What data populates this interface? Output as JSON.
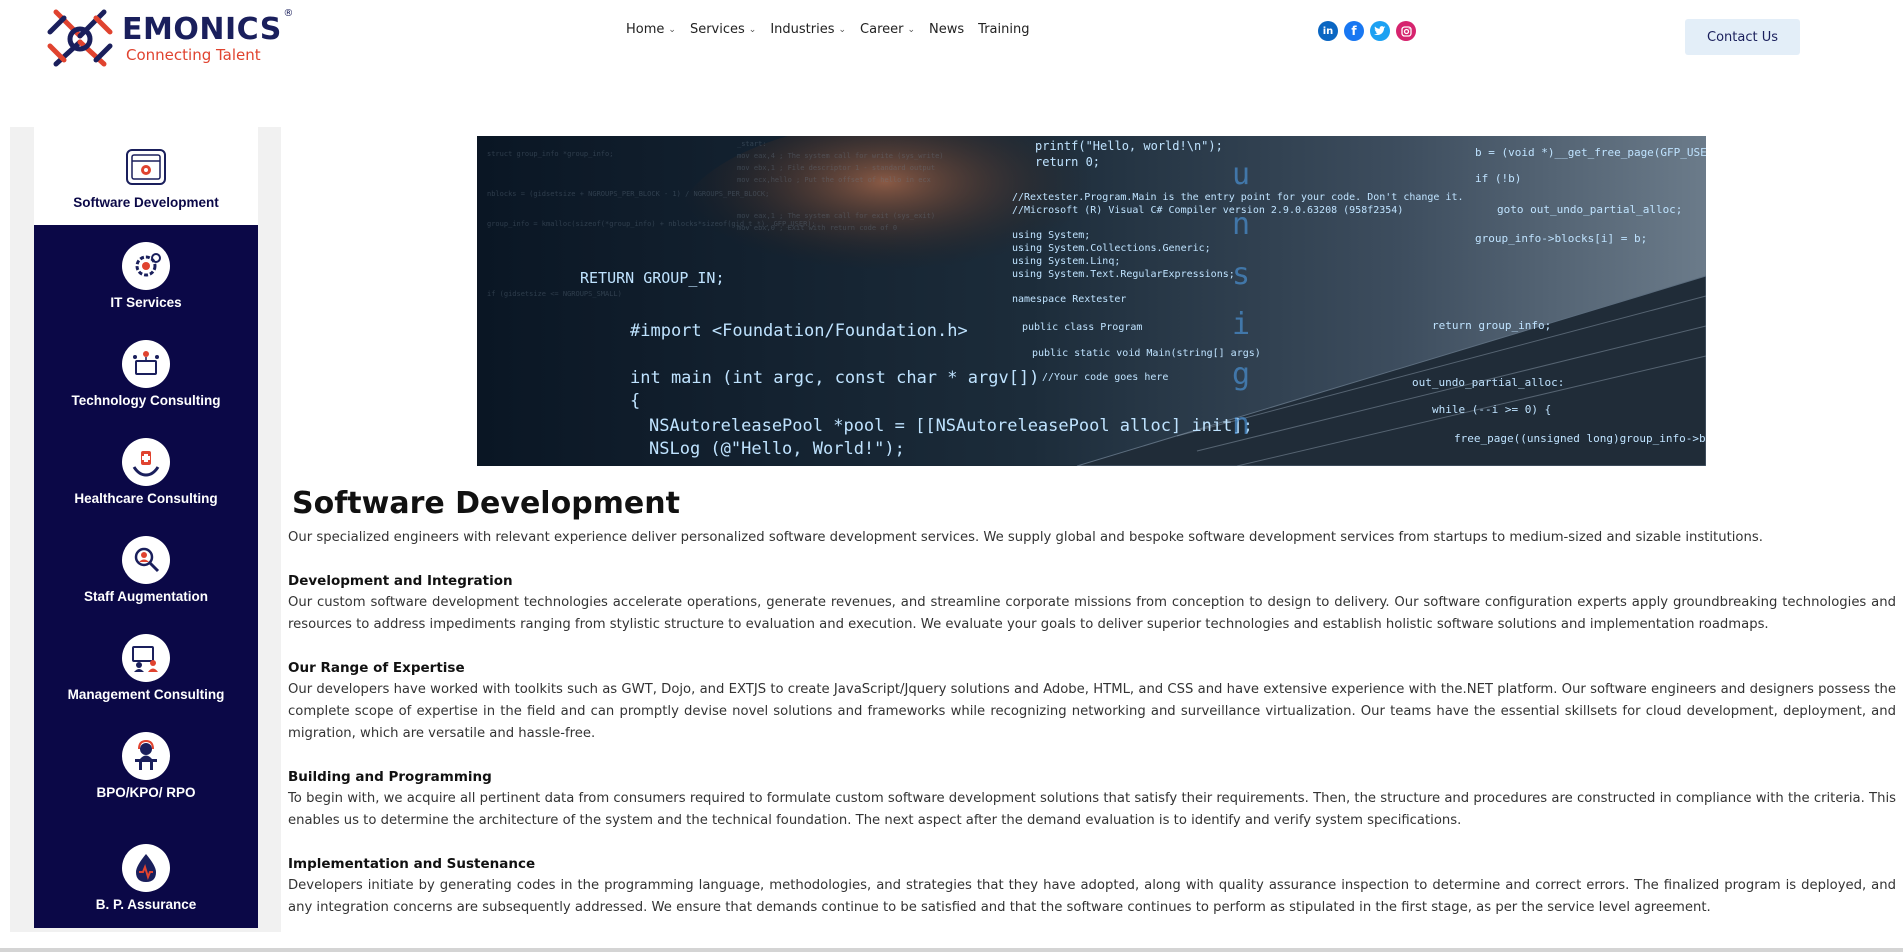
{
  "brand": {
    "name": "EMONICS",
    "registered": "®",
    "tagline": "Connecting Talent"
  },
  "nav": {
    "items": [
      {
        "label": "Home",
        "dropdown": true
      },
      {
        "label": "Services",
        "dropdown": true
      },
      {
        "label": "Industries",
        "dropdown": true
      },
      {
        "label": "Career",
        "dropdown": true
      },
      {
        "label": "News",
        "dropdown": false
      },
      {
        "label": "Training",
        "dropdown": false
      }
    ]
  },
  "social": {
    "icons": [
      "linkedin-icon",
      "facebook-icon",
      "twitter-icon",
      "instagram-icon"
    ]
  },
  "contact": {
    "label": "Contact Us"
  },
  "sidebar": {
    "items": [
      {
        "label": "Software Development",
        "icon": "software-icon",
        "active": true
      },
      {
        "label": "IT Services",
        "icon": "it-services-icon",
        "active": false
      },
      {
        "label": "Technology Consulting",
        "icon": "technology-icon",
        "active": false
      },
      {
        "label": "Healthcare Consulting",
        "icon": "healthcare-icon",
        "active": false
      },
      {
        "label": "Staff Augmentation",
        "icon": "staff-icon",
        "active": false
      },
      {
        "label": "Management Consulting",
        "icon": "management-icon",
        "active": false
      },
      {
        "label": "BPO/KPO/ RPO",
        "icon": "bpo-icon",
        "active": false
      },
      {
        "label": "B. P. Assurance",
        "icon": "assurance-icon",
        "active": false
      }
    ]
  },
  "banner": {
    "code_lines": [
      "#import <Foundation/Foundation.h>",
      "int main (int argc, const char * argv[])",
      "{",
      "NSAutoreleasePool *pool = [[NSAutoreleasePool alloc] init];",
      "NSLog (@\"Hello, World!\");",
      "RETURN GROUP_IN;",
      "printf(\"Hello, world!\\n\");",
      "return 0;",
      "//Rextester.Program.Main is the entry point for your code. Don't change it.",
      "//Microsoft (R) Visual C# Compiler version 2.9.0.63208 (958f2354)",
      "using System;",
      "using System.Collections.Generic;",
      "using System.Linq;",
      "using System.Text.RegularExpressions;",
      "namespace Rextester",
      "public class Program",
      "public static void Main(string[] args)",
      "//Your code goes here",
      "b = (void *)__get_free_page(GFP_USER);",
      "if (!b)",
      "goto out_undo_partial_alloc;",
      "group_info->blocks[i] = b;",
      "return group_info;",
      "out_undo_partial_alloc:",
      "while (--i >= 0) {",
      "free_page((unsigned long)group_info->block"
    ]
  },
  "main": {
    "title": "Software Development",
    "intro": "Our specialized engineers with relevant experience deliver personalized software development services. We supply global and bespoke software development services from startups to medium-sized and sizable institutions.",
    "sections": [
      {
        "heading": "Development and Integration",
        "body": "Our custom software development technologies accelerate operations, generate revenues, and streamline corporate missions from conception to design to delivery. Our software configuration experts apply groundbreaking technologies and resources to address impediments ranging from stylistic structure to evaluation and execution. We evaluate your goals to deliver superior technologies and establish holistic software solutions and implementation roadmaps."
      },
      {
        "heading": "Our Range of Expertise",
        "body": "Our developers have worked with toolkits such as GWT, Dojo, and EXTJS to create JavaScript/Jquery solutions and Adobe, HTML, and CSS and have extensive experience with the.NET platform. Our software engineers and designers possess the complete scope of expertise in the field and can promptly devise novel solutions and frameworks while recognizing networking and surveillance virtualization. Our teams have the essential skillsets for cloud development, deployment, and migration, which are versatile and hassle-free."
      },
      {
        "heading": "Building and Programming",
        "body": "To begin with, we acquire all pertinent data from consumers required to formulate custom software development solutions that satisfy their requirements. Then, the structure and procedures are constructed in compliance with the criteria. This enables us to determine the architecture of the system and the technical foundation. The next aspect after the demand evaluation is to identify and verify system specifications."
      },
      {
        "heading": "Implementation and Sustenance",
        "body": "Developers initiate by generating codes in the programming language, methodologies, and strategies that they have adopted, along with quality assurance inspection to determine and correct errors. The finalized program is deployed, and any integration concerns are subsequently addressed. We ensure that demands continue to be satisfied and that the software continues to perform as stipulated in the first stage, as per the service level agreement."
      }
    ]
  }
}
